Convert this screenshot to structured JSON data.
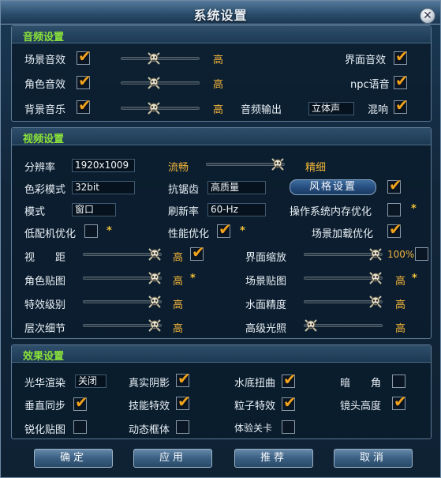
{
  "window": {
    "title": "系统设置",
    "close_glyph": "✕"
  },
  "audio": {
    "title": "音频设置",
    "scene_sound": {
      "label": "场景音效",
      "checked": true,
      "level_text": "高",
      "level": 0.4
    },
    "role_sound": {
      "label": "角色音效",
      "checked": true,
      "level_text": "高",
      "level": 0.4
    },
    "bgm": {
      "label": "背景音乐",
      "checked": true,
      "level_text": "高",
      "level": 0.4
    },
    "ui_sound": {
      "label": "界面音效",
      "checked": true
    },
    "npc_voice": {
      "label": "npc语音",
      "checked": true
    },
    "audio_output": {
      "label": "音频输出",
      "value": "立体声"
    },
    "reverb": {
      "label": "混响",
      "checked": true
    }
  },
  "video": {
    "title": "视频设置",
    "resolution": {
      "label": "分辨率",
      "value": "1920x1009"
    },
    "quality": {
      "left": "流畅",
      "right": "精细",
      "level": 1.0
    },
    "color_mode": {
      "label": "色彩模式",
      "value": "32bit"
    },
    "antialias": {
      "label": "抗锯齿",
      "value": "高质量"
    },
    "style_button": "风格设置",
    "style_checked": true,
    "mode": {
      "label": "模式",
      "value": "窗口"
    },
    "refresh": {
      "label": "刷新率",
      "value": "60-Hz"
    },
    "os_mem": {
      "label": "操作系统内存优化",
      "checked": false,
      "star": "*"
    },
    "low_spec": {
      "label": "低配机优化",
      "checked": false,
      "star": "*"
    },
    "perf_opt": {
      "label": "性能优化",
      "checked": true,
      "star": "*"
    },
    "scene_load": {
      "label": "场景加载优化",
      "checked": true
    },
    "view_distance": {
      "label": "视　　距",
      "level_text": "高",
      "checked": true,
      "level": 1.0
    },
    "ui_scale": {
      "label": "界面缩放",
      "level_text": "100%",
      "checked": false,
      "level": 1.0
    },
    "role_texture": {
      "label": "角色贴图",
      "level_text": "高",
      "star": "*",
      "level": 1.0
    },
    "scene_texture": {
      "label": "场景贴图",
      "level_text": "高",
      "star": "*",
      "level": 1.0
    },
    "effect_level": {
      "label": "特效级别",
      "level_text": "高",
      "level": 1.0
    },
    "water": {
      "label": "水面精度",
      "level_text": "高",
      "level": 1.0
    },
    "lod": {
      "label": "层次细节",
      "level_text": "高",
      "level": 1.0
    },
    "lighting": {
      "label": "高级光照",
      "level_text": "高",
      "level": 0.0
    }
  },
  "effects": {
    "title": "效果设置",
    "bloom": {
      "label": "光华渲染",
      "value": "关闭"
    },
    "shadow": {
      "label": "真实阴影",
      "checked": true
    },
    "underwater": {
      "label": "水底扭曲",
      "checked": true
    },
    "vignette": {
      "label": "暗　　角",
      "checked": false
    },
    "vsync": {
      "label": "垂直同步",
      "checked": true
    },
    "skill_fx": {
      "label": "技能特效",
      "checked": true
    },
    "particle": {
      "label": "粒子特效",
      "checked": true
    },
    "camera_height": {
      "label": "镜头高度",
      "checked": true
    },
    "sharpen": {
      "label": "锐化贴图",
      "checked": false
    },
    "dynamic_frame": {
      "label": "动态框体",
      "checked": false
    },
    "trial_card": {
      "label": "体验关卡",
      "checked": false
    }
  },
  "buttons": {
    "confirm": "确定",
    "apply": "应用",
    "recommend": "推荐",
    "cancel": "取消"
  },
  "icons": {
    "check": "✔",
    "slider_knob": "skull-knob-icon"
  }
}
